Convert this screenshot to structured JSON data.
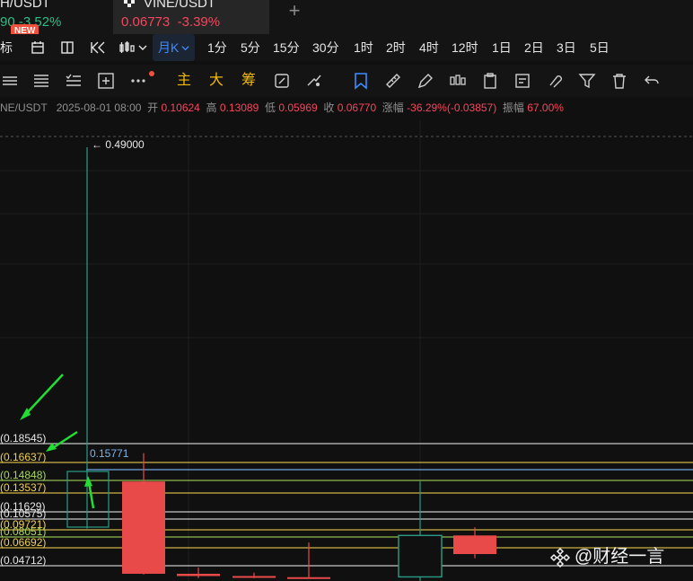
{
  "tabs": [
    {
      "symbol": "H/USDT",
      "price": "90",
      "change": "-3.52%",
      "change_color": "#2ebd85",
      "badge": "NEW"
    },
    {
      "symbol": "VINE/USDT",
      "price": "0.06773",
      "change": "-3.39%",
      "change_color": "#f6465d",
      "active": true
    }
  ],
  "toolbar": {
    "indicator_label": "标",
    "active_interval": "月K",
    "intervals": [
      "1分",
      "5分",
      "15分",
      "30分",
      "1时",
      "2时",
      "4时",
      "12时",
      "1日",
      "2日",
      "3日",
      "5日"
    ]
  },
  "draw_toolbar": {
    "text_buttons": [
      "主",
      "大",
      "筹"
    ],
    "icons": [
      "lines-icon",
      "align-icon",
      "list-check-icon",
      "add-box-icon",
      "more-icon",
      "crop-icon",
      "sync-icon",
      "arrows-icon",
      "bookmark-icon",
      "ruler-icon",
      "pen-icon",
      "candles-icon",
      "clipboard-icon",
      "note-icon",
      "magnet-icon",
      "filter-icon",
      "trash-icon",
      "undo-icon"
    ]
  },
  "ohlc": {
    "symbol": "NE/USDT",
    "date": "2025-08-01 08:00",
    "open_label": "开",
    "open": "0.10624",
    "high_label": "高",
    "high": "0.13089",
    "low_label": "低",
    "low": "0.05969",
    "close_label": "收",
    "close": "0.06770",
    "change_label": "涨幅",
    "change": "-36.29%(-0.03857)",
    "amplitude_label": "振幅",
    "amplitude": "67.00%"
  },
  "chart_data": {
    "type": "candlestick",
    "interval": "月K",
    "peak_marker": "← 0.49000",
    "box_value": "0.15771",
    "levels": [
      {
        "label": "(0.18545)",
        "value": 0.18545,
        "color": "#e6e6e6"
      },
      {
        "label": "(0.16637)",
        "value": 0.16637,
        "color": "#f0d050"
      },
      {
        "label": "(0.14848)",
        "value": 0.14848,
        "color": "#a6d85a"
      },
      {
        "label": "(0.13537)",
        "value": 0.13537,
        "color": "#f0d050"
      },
      {
        "label": "(0.11629)",
        "value": 0.11629,
        "color": "#e6e6e6"
      },
      {
        "label": "(0.10575)",
        "value": 0.10575,
        "color": "#e6e6e6"
      },
      {
        "label": "(0.09721)",
        "value": 0.09721,
        "color": "#f0d050"
      },
      {
        "label": "(0.08051)",
        "value": 0.08051,
        "color": "#a6d85a"
      },
      {
        "label": "(0.06692)",
        "value": 0.06692,
        "color": "#f0d050"
      },
      {
        "label": "(0.04712)",
        "value": 0.04712,
        "color": "#e6e6e6"
      }
    ],
    "candles": [
      {
        "open": 0.1285,
        "high": 0.49,
        "low": 0.0982,
        "close": 0.1285,
        "hollow": true,
        "color": "#2a9c86"
      },
      {
        "open": 0.1474,
        "high": 0.1758,
        "low": 0.0378,
        "close": 0.0386,
        "color": "#e84a4a"
      },
      {
        "open": 0.0386,
        "high": 0.0452,
        "low": 0.034,
        "close": 0.0362,
        "color": "#e84a4a"
      },
      {
        "open": 0.0362,
        "high": 0.0398,
        "low": 0.034,
        "close": 0.035,
        "color": "#e84a4a"
      },
      {
        "open": 0.035,
        "high": 0.0734,
        "low": 0.034,
        "close": 0.0342,
        "color": "#e84a4a"
      },
      {
        "open": 0.0353,
        "high": 0.1474,
        "low": 0.031,
        "close": 0.0841,
        "hollow": true,
        "color": "#2a9c86"
      },
      {
        "open": 0.0841,
        "high": 0.0992,
        "low": 0.0554,
        "close": 0.06,
        "color": "#e84a4a"
      }
    ],
    "y_range": [
      0.03,
      0.52
    ]
  },
  "watermark": "@财经一言"
}
